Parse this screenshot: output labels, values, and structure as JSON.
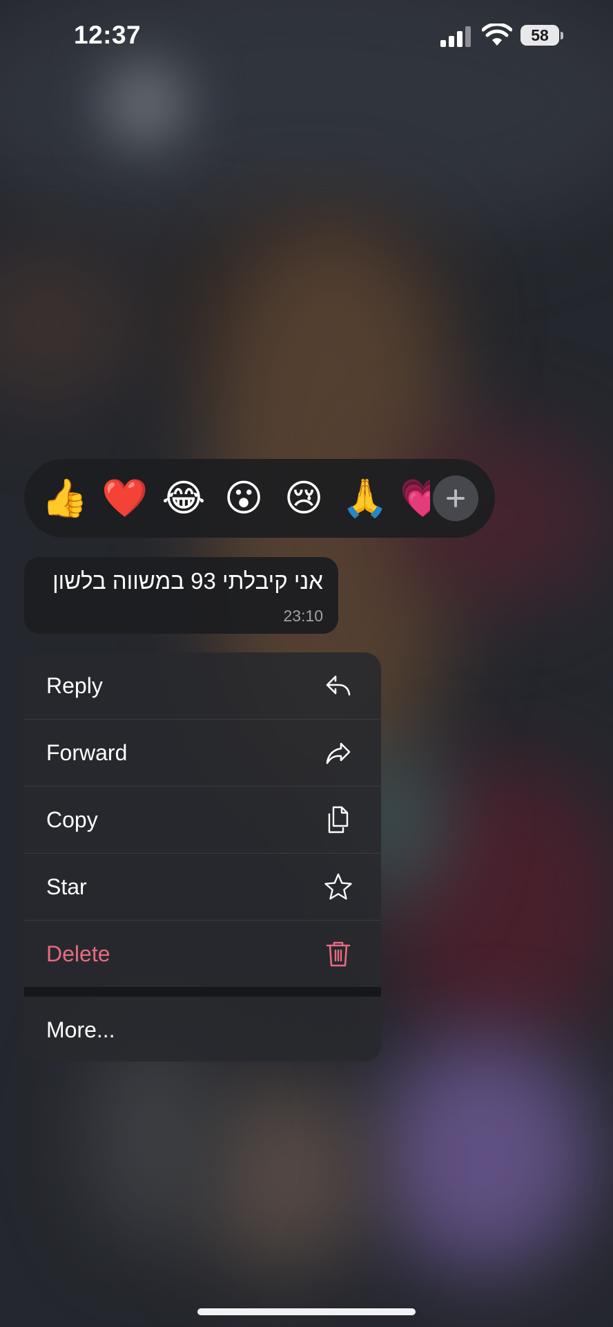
{
  "status_bar": {
    "time": "12:37",
    "battery": "58"
  },
  "reactions": {
    "emojis": [
      "👍",
      "❤️",
      "😂",
      "😮",
      "😢",
      "🙏",
      "💗"
    ],
    "add_icon": "plus-icon"
  },
  "message": {
    "text": "אני קיבלתי 93 במשווה בלשון",
    "time": "23:10"
  },
  "menu": {
    "reply": "Reply",
    "forward": "Forward",
    "copy": "Copy",
    "star": "Star",
    "delete": "Delete",
    "more": "More..."
  },
  "colors": {
    "delete": "#e86b82",
    "menu_bg": "#28292d",
    "bubble_bg": "#1c1d21"
  }
}
